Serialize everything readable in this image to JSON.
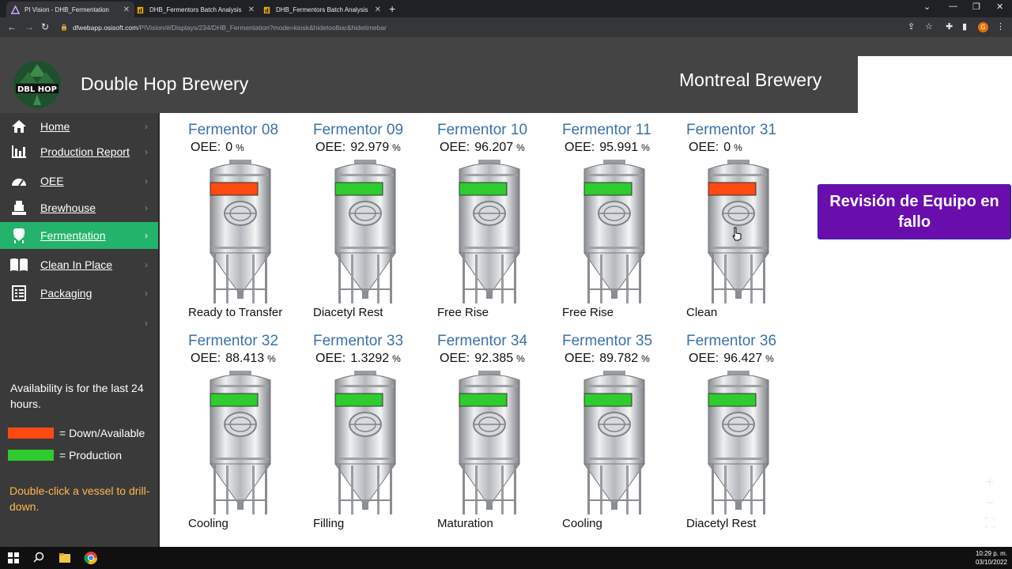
{
  "browser": {
    "tabs": [
      {
        "label": "PI Vision - DHB_Fermentation",
        "active": true
      },
      {
        "label": "DHB_Fermentors Batch Analysis",
        "active": false
      },
      {
        "label": "DHB_Fermentors Batch Analysis",
        "active": false
      }
    ],
    "url_host": "dfwebapp.osisoft.com",
    "url_path": "/PIVision/#/Displays/234/DHB_Fermentation?mode=kiosk&hidetoolbar&hidetimebar",
    "profile_initial": "G"
  },
  "header": {
    "title": "Double Hop Brewery",
    "site": "Montreal Brewery",
    "logo_text": "DBL HOP"
  },
  "sidebar": {
    "items": [
      {
        "label": "Home",
        "icon": "home-icon"
      },
      {
        "label": "Production Report",
        "icon": "bar-chart-icon"
      },
      {
        "label": "OEE",
        "icon": "gauge-icon"
      },
      {
        "label": "Brewhouse",
        "icon": "brewhouse-icon"
      },
      {
        "label": "Fermentation",
        "icon": "fermenter-icon",
        "active": true
      },
      {
        "label": "Clean In Place",
        "icon": "book-icon"
      },
      {
        "label": "Packaging",
        "icon": "checklist-icon"
      },
      {
        "label": ""
      }
    ],
    "availability_note": "Availability is for the last 24 hours.",
    "legend": [
      {
        "label": "= Down/Available",
        "color": "#ff4a12"
      },
      {
        "label": "= Production",
        "color": "#2ecc2e"
      }
    ],
    "hint": "Double-click a vessel to drill-down."
  },
  "oee_label": "OEE:",
  "oee_unit": "%",
  "vessels": [
    {
      "name": "Fermentor 08",
      "oee": "0",
      "status": "Ready to Transfer",
      "state": "down"
    },
    {
      "name": "Fermentor 09",
      "oee": "92.979",
      "status": "Diacetyl Rest",
      "state": "production"
    },
    {
      "name": "Fermentor 10",
      "oee": "96.207",
      "status": "Free Rise",
      "state": "production"
    },
    {
      "name": "Fermentor 11",
      "oee": "95.991",
      "status": "Free Rise",
      "state": "production"
    },
    {
      "name": "Fermentor 31",
      "oee": "0",
      "status": "Clean",
      "state": "down"
    },
    {
      "name": "Fermentor 32",
      "oee": "88.413",
      "status": "Cooling",
      "state": "production"
    },
    {
      "name": "Fermentor 33",
      "oee": "1.3292",
      "status": "Filling",
      "state": "production"
    },
    {
      "name": "Fermentor 34",
      "oee": "92.385",
      "status": "Maturation",
      "state": "production"
    },
    {
      "name": "Fermentor 35",
      "oee": "89.782",
      "status": "Cooling",
      "state": "production"
    },
    {
      "name": "Fermentor 36",
      "oee": "96.427",
      "status": "Diacetyl Rest",
      "state": "production"
    }
  ],
  "action_button": "Revisión de Equipo en fallo",
  "colors": {
    "down": "#ff4a12",
    "production": "#2ecc2e",
    "active_nav": "#24b36b",
    "vessel_title": "#3a72a8"
  },
  "taskbar": {
    "time": "10:29 p. m.",
    "date": "03/10/2022"
  }
}
